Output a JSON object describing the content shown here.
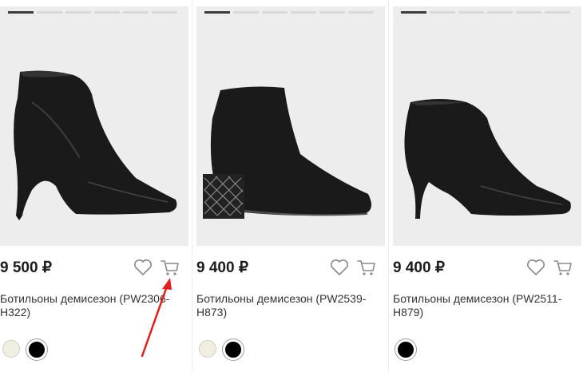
{
  "products": [
    {
      "price": "9 500 ₽",
      "title_line1": "Ботильоны демисезон (PW2306-",
      "title_line2": "H322)",
      "carousel": {
        "total": 6,
        "active": 0
      },
      "colors": [
        "#f1efe1",
        "#000000"
      ],
      "selected_color": "#000000"
    },
    {
      "price": "9 400 ₽",
      "title_line1": "Ботильоны демисезон (PW2539-",
      "title_line2": "H873)",
      "carousel": {
        "total": 6,
        "active": 0
      },
      "colors": [
        "#f1efe1",
        "#000000"
      ],
      "selected_color": "#000000"
    },
    {
      "price": "9 400 ₽",
      "title_line1": "Ботильоны демисезон (PW2511-",
      "title_line2": "H879)",
      "carousel": {
        "total": 6,
        "active": 0
      },
      "colors": [
        "#000000"
      ],
      "selected_color": "#000000"
    }
  ],
  "icons": {
    "favorite": "heart-icon",
    "cart": "cart-icon"
  },
  "theme": {
    "image_bg": "#eeedee",
    "annotation_arrow": "#e0201e"
  }
}
